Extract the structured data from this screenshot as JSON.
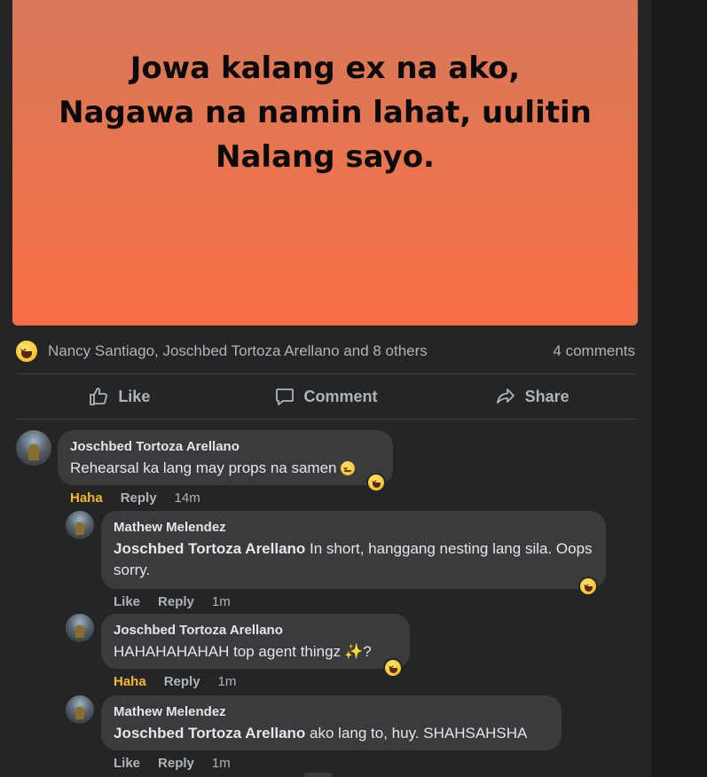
{
  "post": {
    "banner_text": "Jowa kalang ex na ako,\nNagawa na namin lahat, uulitin\nNalang sayo.",
    "banner_colors": [
      "#d7785a",
      "#f86f46"
    ]
  },
  "reactions": {
    "icon": "haha-emoji-icon",
    "names": "Nancy Santiago, Joschbed Tortoza Arellano and 8 others",
    "comments_count": "4 comments"
  },
  "actions": {
    "like": "Like",
    "comment": "Comment",
    "share": "Share"
  },
  "comments": [
    {
      "author": "Joschbed Tortoza Arellano",
      "text": "Rehearsal ka lang may props na samen",
      "reaction_label": "Haha",
      "reply": "Reply",
      "time": "14m"
    },
    {
      "author": "Mathew Melendez",
      "mention": "Joschbed Tortoza Arellano",
      "text": " In short, hanggang nesting lang sila. Oops sorry.",
      "reaction_label": "Like",
      "reply": "Reply",
      "time": "1m"
    },
    {
      "author": "Joschbed Tortoza Arellano",
      "text": "HAHAHAHAHAH top agent thingz",
      "text_suffix": "?",
      "reaction_label": "Haha",
      "reply": "Reply",
      "time": "1m"
    },
    {
      "author": "Mathew Melendez",
      "mention": "Joschbed Tortoza Arellano",
      "text": " ako lang to, huy. SHAHSAHSHA",
      "reaction_label": "Like",
      "reply": "Reply",
      "time": "1m"
    }
  ],
  "colors": {
    "background": "#242526",
    "bubble": "#3a3b3c",
    "haha": "#f7b928",
    "muted_text": "#b0b3b8"
  }
}
